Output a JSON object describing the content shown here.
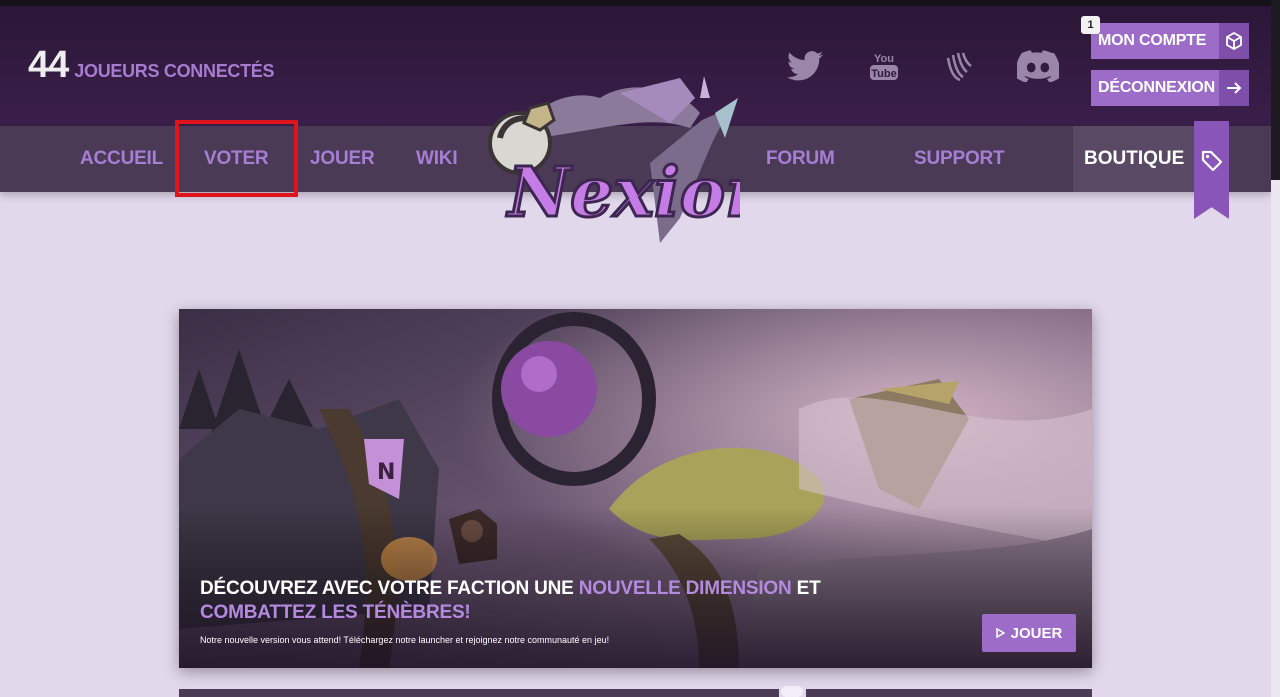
{
  "header": {
    "players_count": "44",
    "players_label": "JOUEURS CONNECTÉS",
    "social": [
      {
        "name": "twitter-icon"
      },
      {
        "name": "youtube-icon",
        "text_top": "You",
        "text_bottom": "Tube"
      },
      {
        "name": "vanilla-forums-icon"
      },
      {
        "name": "discord-icon"
      }
    ],
    "account": {
      "badge": "1",
      "my_account_label": "MON COMPTE",
      "logout_label": "DÉCONNEXION"
    }
  },
  "nav": {
    "items": [
      "ACCUEIL",
      "VOTER",
      "JOUER",
      "WIKI",
      "FORUM",
      "SUPPORT"
    ],
    "shop_label": "BOUTIQUE",
    "logo_text": "Nexion"
  },
  "hero": {
    "title_part1": "DÉCOUVREZ AVEC VOTRE FACTION UNE ",
    "title_highlight1": "NOUVELLE DIMENSION",
    "title_part2": " ET ",
    "title_highlight2": "COMBATTEZ LES TÉNÈBRES!",
    "subtitle": "Notre nouvelle version vous attend! Téléchargez notre launcher et rejoignez notre communauté en jeu!",
    "play_label": "JOUER"
  },
  "colors": {
    "accent": "#9c6cc8",
    "nav_text": "#a67ed4",
    "header_bg": "#2a1636",
    "nav_bg": "#4a3a55",
    "page_bg": "#e2d8ec",
    "highlight_box": "#e0141c"
  }
}
